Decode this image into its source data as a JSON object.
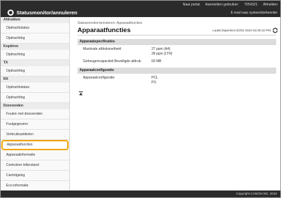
{
  "header": {
    "links": [
      "Naar portal",
      "Aanmelden gebruiker:",
      "7654321",
      "Afmelden"
    ],
    "title": "Statusmonitor/annuleren",
    "mail_link": "E-mail naar systeembeheerder"
  },
  "sidebar": {
    "sections": [
      {
        "title": "Afdrukken",
        "items": [
          "Opdrachtstatus",
          "Opdrachtlog"
        ]
      },
      {
        "title": "Kopiëren",
        "items": [
          "Opdrachtlog"
        ]
      },
      {
        "title": "TX",
        "items": [
          "Opdrachtlog"
        ]
      },
      {
        "title": "RX",
        "items": [
          "Opdrachtstatus",
          "Opdrachtlog"
        ]
      },
      {
        "title": "Doorzenden",
        "items": [
          "Fouten met doorzenden"
        ]
      }
    ],
    "other_items": [
      "Foutgegevens",
      "Verbruiksartikelen",
      "Apparaatfuncties",
      "Apparaatinformatie",
      "Controleer tellerstand",
      "Cartridgelog",
      "Eco-informatie"
    ],
    "active_item": "Apparaatfuncties"
  },
  "main": {
    "breadcrumb": "Statusmonitor/annuleren: Apparaatfuncties",
    "title": "Apparaatfuncties",
    "updated": "Laatst bijwerken:02/02 2019 03:29:10 PM",
    "spec_title": "Apparaatspecificaties",
    "spec_rows": [
      {
        "label": "Maximale afdruksnelheid:",
        "values": [
          "27 ppm (A4)",
          "28 ppm (LTR)"
        ]
      },
      {
        "label": "Geheugencapaciteit Beveiligde afdruk:",
        "values": [
          "60 MB"
        ]
      }
    ],
    "config_title": "Apparaatconfiguratie",
    "config_rows": [
      {
        "label": "Apparaatconfiguratie",
        "values": [
          "PCL",
          "PS"
        ]
      }
    ]
  },
  "footer": {
    "copyright": "Copyright CANON INC. 2018"
  }
}
